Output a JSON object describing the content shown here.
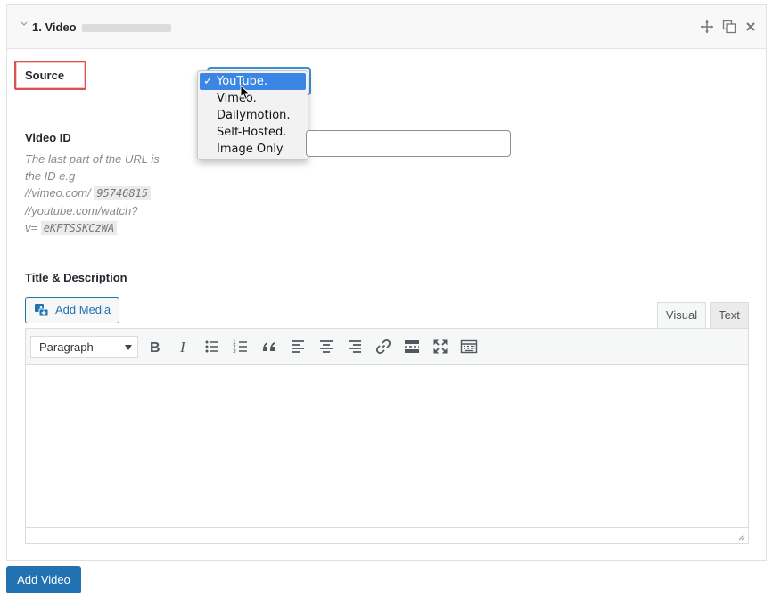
{
  "panel": {
    "title": "1. Video"
  },
  "source": {
    "label": "Source",
    "options": [
      "YouTube.",
      "Vimeo.",
      "Dailymotion.",
      "Self-Hosted.",
      "Image Only"
    ],
    "selected": "YouTube.",
    "check": "✓"
  },
  "video_id": {
    "label": "Video ID",
    "value": "",
    "help_line1": "The last part of the URL is the ID e.g",
    "help_vimeo_prefix": "//vimeo.com/",
    "help_vimeo_code": "95746815",
    "help_youtube_prefix": "//youtube.com/watch?",
    "help_v_prefix": "v=",
    "help_youtube_code": "eKFTSSKCzWA"
  },
  "description": {
    "label": "Title & Description",
    "add_media": "Add Media",
    "tab_visual": "Visual",
    "tab_text": "Text",
    "format_select": "Paragraph"
  },
  "footer": {
    "add_video": "Add Video"
  },
  "colors": {
    "primary": "#2271b1",
    "highlight_border": "#d9534f",
    "dropdown_selected": "#3b86e4"
  }
}
